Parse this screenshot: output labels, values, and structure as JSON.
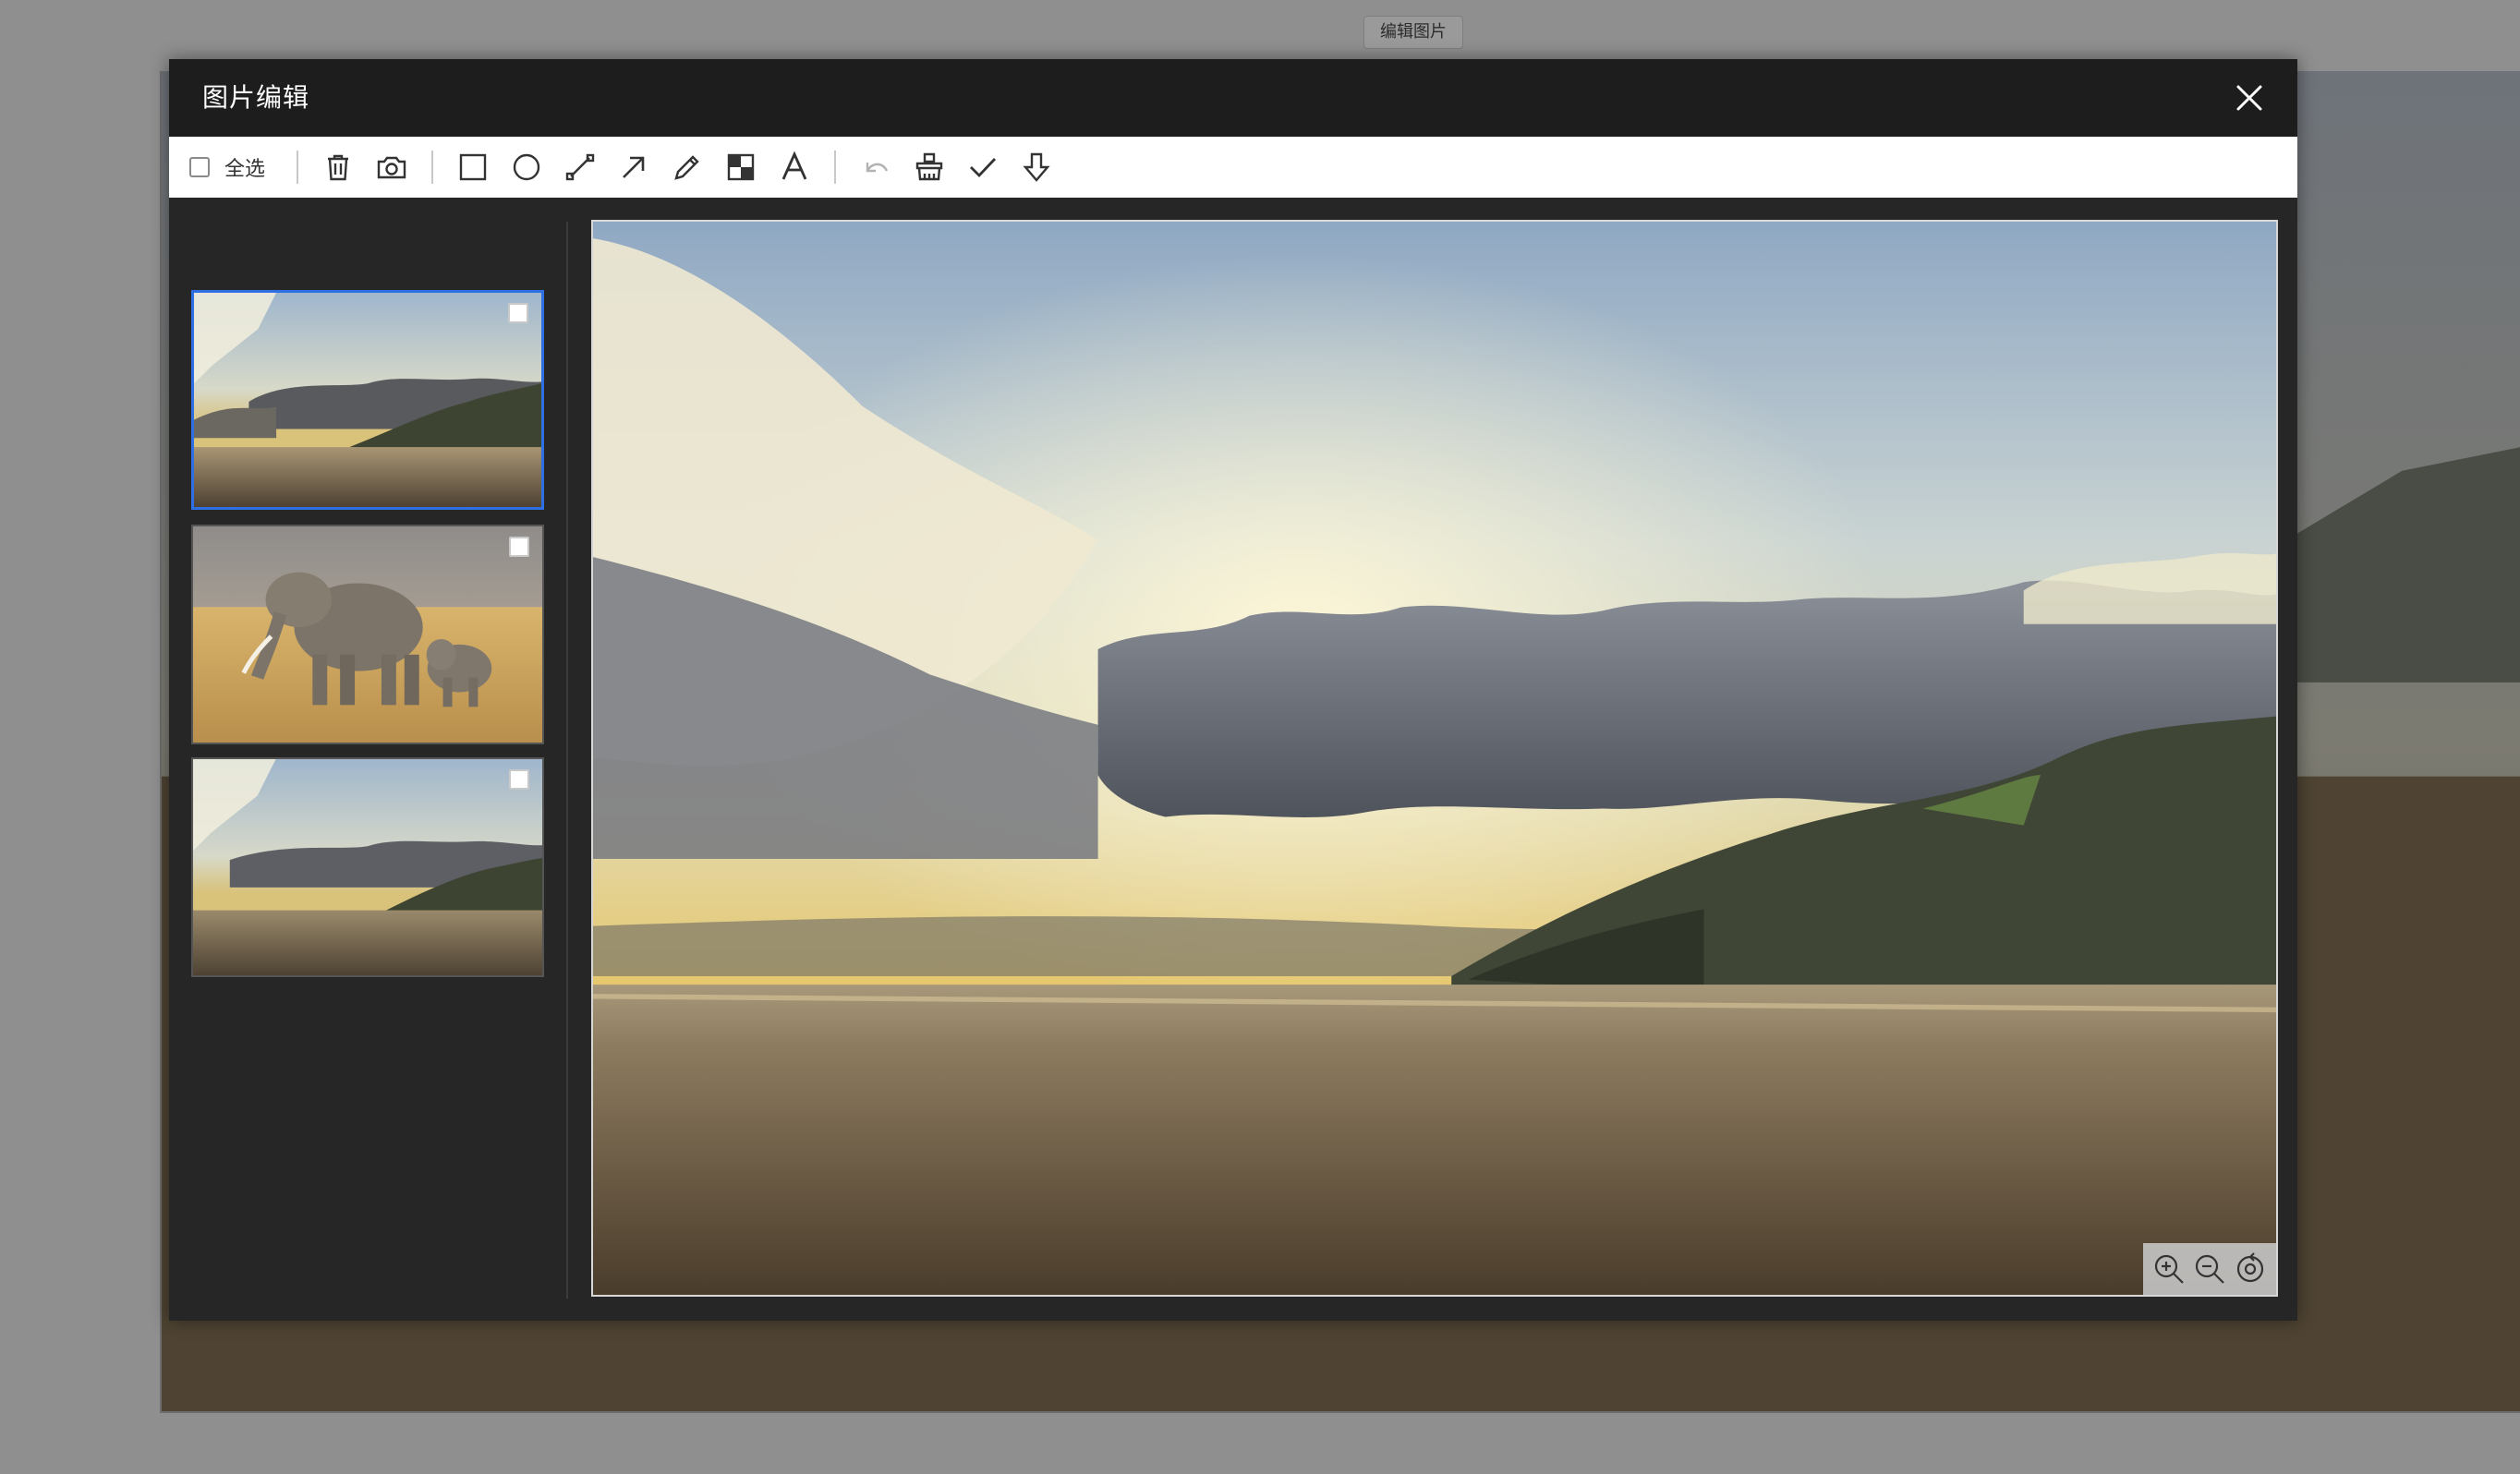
{
  "background_page": {
    "edit_button_label": "编辑图片"
  },
  "modal": {
    "title": "图片编辑"
  },
  "toolbar": {
    "select_all_label": "全选",
    "tools": [
      {
        "name": "delete",
        "icon": "trash-icon"
      },
      {
        "name": "screenshot",
        "icon": "camera-icon"
      },
      {
        "name": "rectangle",
        "icon": "rectangle-icon"
      },
      {
        "name": "ellipse",
        "icon": "circle-icon"
      },
      {
        "name": "line",
        "icon": "line-icon"
      },
      {
        "name": "arrow",
        "icon": "arrow-icon"
      },
      {
        "name": "pencil",
        "icon": "pencil-icon"
      },
      {
        "name": "mosaic",
        "icon": "mosaic-icon"
      },
      {
        "name": "text",
        "icon": "text-icon"
      },
      {
        "name": "undo",
        "icon": "undo-icon",
        "disabled": true
      },
      {
        "name": "clear",
        "icon": "eraser-icon"
      },
      {
        "name": "confirm",
        "icon": "check-icon"
      },
      {
        "name": "download",
        "icon": "download-icon"
      }
    ]
  },
  "thumbnails": [
    {
      "subject": "beach-sunset",
      "selected": true,
      "checked": false
    },
    {
      "subject": "elephants",
      "selected": false,
      "checked": false
    },
    {
      "subject": "beach-sunset",
      "selected": false,
      "checked": false
    }
  ],
  "viewer": {
    "zoom_controls": [
      {
        "name": "zoom-in",
        "icon": "zoom-in-icon"
      },
      {
        "name": "zoom-out",
        "icon": "zoom-out-icon"
      },
      {
        "name": "reset",
        "icon": "reset-icon"
      }
    ]
  },
  "colors": {
    "header_bg": "#1d1d1d",
    "body_bg": "#262626",
    "overlay": "#8f8f8f",
    "selected_border": "#2f6fe4"
  }
}
